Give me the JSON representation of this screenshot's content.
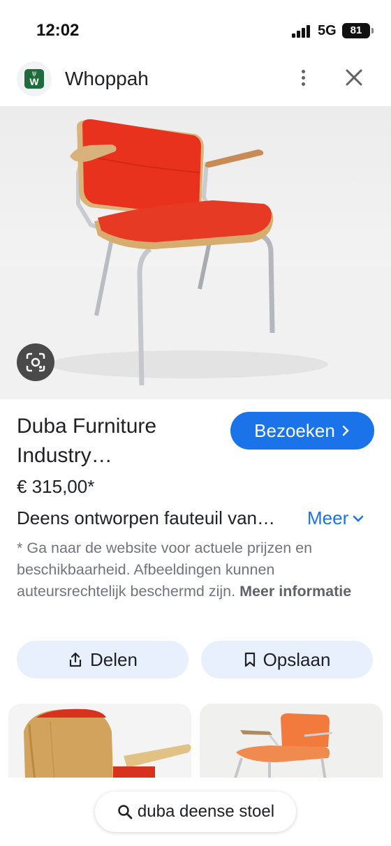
{
  "status_bar": {
    "time": "12:02",
    "network": "5G",
    "battery": "81"
  },
  "header": {
    "site_name": "Whoppah",
    "logo_letter": "W"
  },
  "product": {
    "title_line1": "Duba Furniture",
    "title_line2": "Industry…",
    "visit_label": "Bezoeken",
    "price": "€ 315,00*",
    "description": "Deens ontworpen fauteuil van…",
    "more_label": "Meer",
    "disclaimer": "* Ga naar de website voor actuele prijzen en beschikbaarheid. Afbeeldingen kunnen auteursrechtelijk beschermd zijn. ",
    "more_info_label": "Meer informatie"
  },
  "actions": {
    "share_label": "Delen",
    "save_label": "Opslaan"
  },
  "search": {
    "query": "duba deense stoel"
  },
  "colors": {
    "accent": "#1a73e8",
    "chip_bg": "#e8f0fe",
    "chair_red": "#e8321e",
    "logo_green": "#1e6b3c"
  },
  "icons": [
    "site-logo",
    "more-vert-icon",
    "close-icon",
    "lens-icon",
    "chevron-right-icon",
    "chevron-down-icon",
    "share-icon",
    "bookmark-icon",
    "search-icon"
  ]
}
